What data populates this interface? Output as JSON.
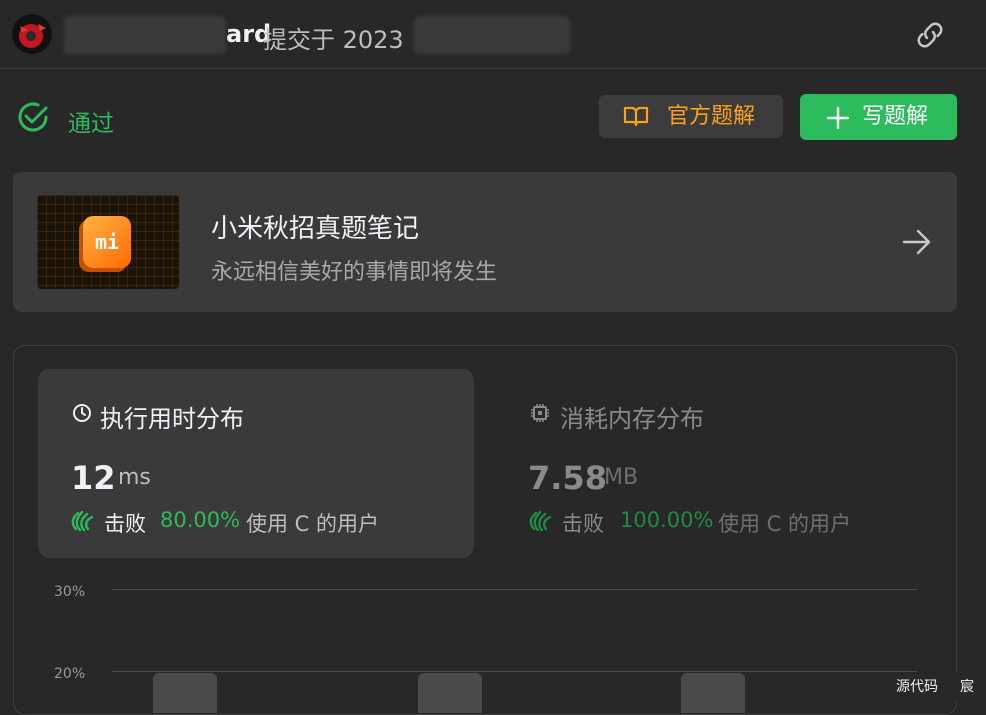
{
  "header": {
    "username_visible": "ard",
    "submitted_prefix": "提交于 2023"
  },
  "status": {
    "label": "通过",
    "color": "#2cbb5d"
  },
  "actions": {
    "official_solution": "官方题解",
    "write_solution": "写题解"
  },
  "promo": {
    "logo_text": "mi",
    "title": "小米秋招真题笔记",
    "subtitle": "永远相信美好的事情即将发生"
  },
  "runtime": {
    "title": "执行用时分布",
    "value": "12",
    "unit": "ms",
    "beat_prefix": "击败",
    "percent": "80.00%",
    "beat_suffix": "使用 C 的用户"
  },
  "memory": {
    "title": "消耗内存分布",
    "value": "7.58",
    "unit": "MB",
    "beat_prefix": "击败",
    "percent": "100.00%",
    "beat_suffix": "使用 C 的用户"
  },
  "chart_data": {
    "type": "bar",
    "y_ticks": [
      "30%",
      "20%"
    ]
  },
  "footer": {
    "source_tab": "源代码",
    "other_tab": "宸"
  },
  "colors": {
    "accent_green": "#2cbb5d",
    "accent_orange": "#ffa116",
    "background": "#282828"
  }
}
